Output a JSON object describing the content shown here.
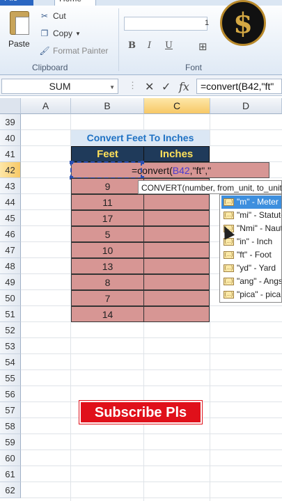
{
  "ribbon": {
    "tabs": [
      "File",
      "Home"
    ],
    "clipboard": {
      "paste_label": "Paste",
      "cut_label": "Cut",
      "copy_label": "Copy",
      "format_painter_label": "Format Painter",
      "group_label": "Clipboard"
    },
    "font": {
      "size_value": "1",
      "bold": "B",
      "italic": "I",
      "underline": "U",
      "group_label": "Font"
    },
    "logo_symbol": "$"
  },
  "formula_bar": {
    "name_box": "SUM",
    "cancel_icon": "✕",
    "enter_icon": "✓",
    "fx_label": "fx",
    "formula": "=convert(B42,\"ft\""
  },
  "columns": [
    "A",
    "B",
    "C",
    "D"
  ],
  "rows": [
    "39",
    "40",
    "41",
    "42",
    "43",
    "44",
    "45",
    "46",
    "47",
    "48",
    "49",
    "50",
    "51",
    "52",
    "53",
    "54",
    "55",
    "56",
    "57",
    "58",
    "59",
    "60",
    "61",
    "62"
  ],
  "table": {
    "title": "Convert Feet To Inches",
    "headers": [
      "Feet",
      "Inches"
    ],
    "feet_values": [
      "9",
      "11",
      "17",
      "5",
      "10",
      "13",
      "8",
      "7",
      "14"
    ]
  },
  "active_cell": {
    "prefix": "=convert(",
    "ref": "B42",
    "suffix": ",\"ft\",\""
  },
  "tooltip": "CONVERT(number, from_unit, to_unit)",
  "dropdown": [
    "\"m\" - Meter",
    "\"mi\" - Statute mile",
    "\"Nmi\" - Nautical mile",
    "\"in\" - Inch",
    "\"ft\" - Foot",
    "\"yd\" - Yard",
    "\"ang\" - Angstrom",
    "\"pica\" - pica"
  ],
  "overlay": {
    "subscribe_text": "Subscribe Pls"
  },
  "colors": {
    "header_bg": "#1f3a5a",
    "header_text": "#ffe15a",
    "cell_fill": "#d79694",
    "title_text": "#1f72c4",
    "subscribe_bg": "#e0101a"
  }
}
